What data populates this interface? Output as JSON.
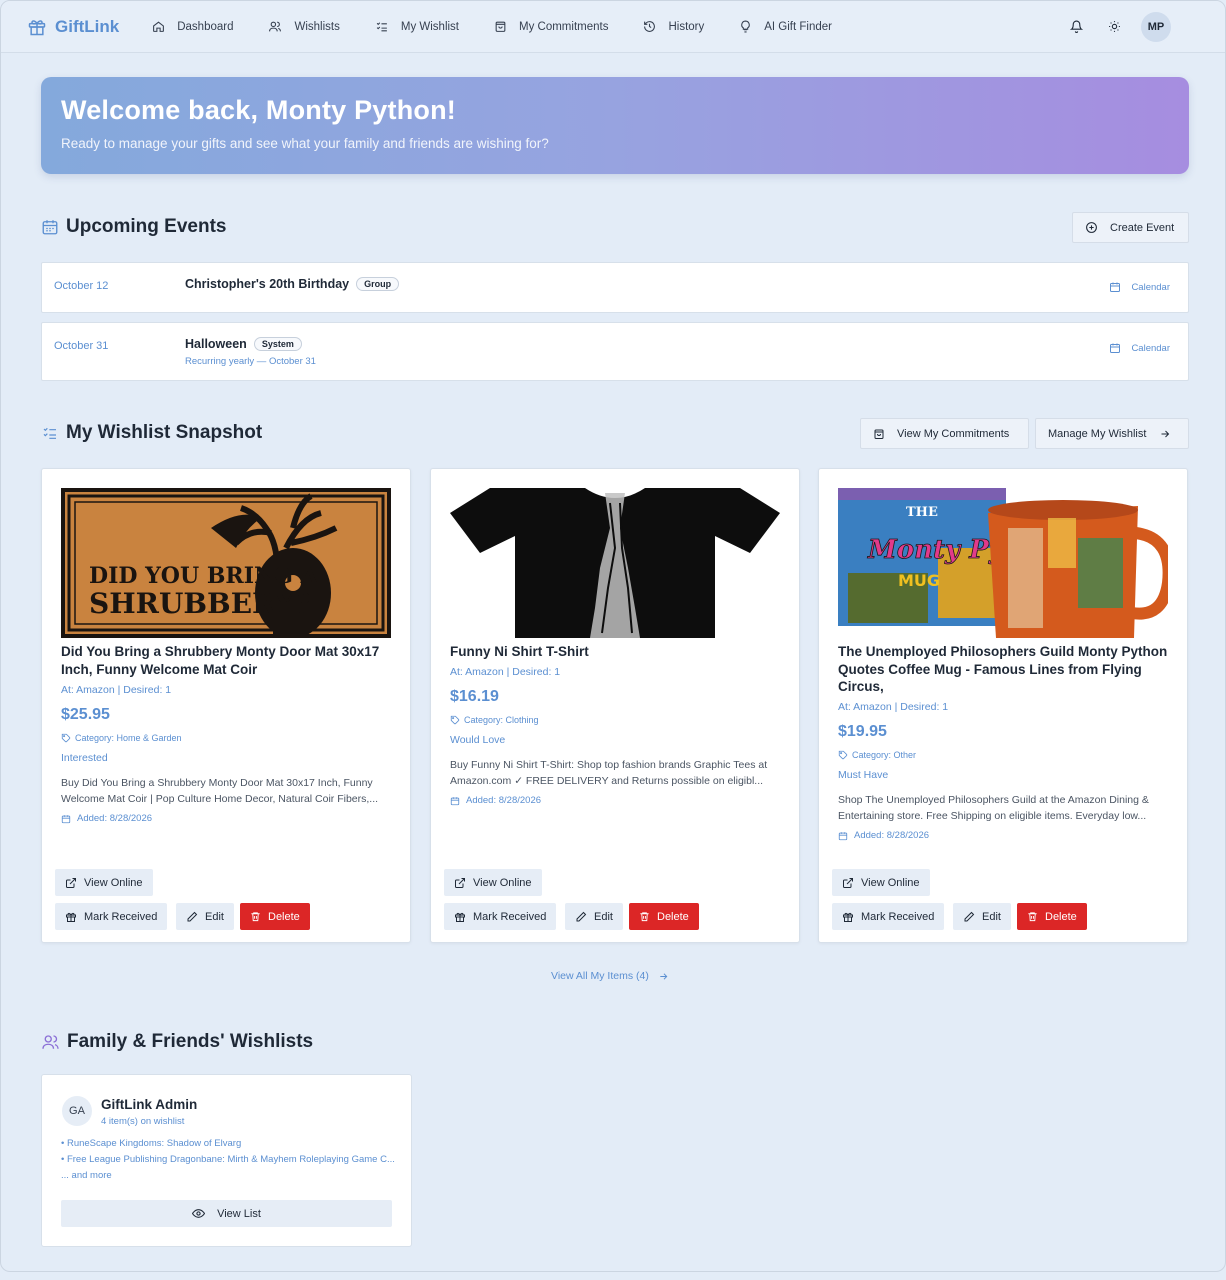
{
  "nav": {
    "brand": "GiftLink",
    "items": [
      {
        "label": "Dashboard",
        "icon": "home-icon"
      },
      {
        "label": "Wishlists",
        "icon": "users-icon"
      },
      {
        "label": "My Wishlist",
        "icon": "list-check-icon"
      },
      {
        "label": "My Commitments",
        "icon": "shopping-bag-icon"
      },
      {
        "label": "History",
        "icon": "history-icon"
      },
      {
        "label": "AI Gift Finder",
        "icon": "lightbulb-icon"
      }
    ],
    "avatar_initials": "MP"
  },
  "hero": {
    "title": "Welcome back, Monty Python!",
    "subtitle": "Ready to manage your gifts and see what your family and friends are wishing for?"
  },
  "events": {
    "title": "Upcoming Events",
    "create_label": "Create Event",
    "items": [
      {
        "date": "October 12",
        "title": "Christopher's 20th Birthday",
        "tag": "Group",
        "subtitle": "",
        "calendar_label": "Calendar"
      },
      {
        "date": "October 31",
        "title": "Halloween",
        "tag": "System",
        "subtitle": "Recurring yearly — October 31",
        "calendar_label": "Calendar"
      }
    ]
  },
  "wishlist": {
    "title": "My Wishlist Snapshot",
    "view_commitments_label": "View My Commitments",
    "manage_label": "Manage My Wishlist",
    "view_all_label": "View All My Items (4)",
    "items": [
      {
        "title": "Did You Bring a Shrubbery Monty Door Mat 30x17 Inch, Funny Welcome Mat Coir",
        "meta": "At: Amazon | Desired: 1",
        "price": "$25.95",
        "category": "Category: Home & Garden",
        "priority": "Interested",
        "description": "Buy Did You Bring a Shrubbery Monty Door Mat 30x17 Inch, Funny Welcome Mat Coir | Pop Culture Home Decor, Natural Coir Fibers,...",
        "added": "Added: 8/28/2026",
        "image_text_line1": "DID YOU BRING A",
        "image_text_line2": "SHRUBBERY?"
      },
      {
        "title": "Funny Ni Shirt T-Shirt",
        "meta": "At: Amazon | Desired: 1",
        "price": "$16.19",
        "category": "Category: Clothing",
        "priority": "Would Love",
        "description": "Buy Funny Ni Shirt T-Shirt: Shop top fashion brands Graphic Tees at Amazon.com ✓ FREE DELIVERY and Returns possible on eligibl...",
        "added": "Added: 8/28/2026"
      },
      {
        "title": "The Unemployed Philosophers Guild Monty Python Quotes Coffee Mug - Famous Lines from Flying Circus,",
        "meta": "At: Amazon | Desired: 1",
        "price": "$19.95",
        "category": "Category: Other",
        "priority": "Must Have",
        "description": "Shop The Unemployed Philosophers Guild at the Amazon Dining & Entertaining store. Free Shipping on eligible items. Everyday low...",
        "added": "Added: 8/28/2026",
        "image_text_the": "THE",
        "image_text_brand": "Monty Python",
        "image_text_mug": "MUG"
      }
    ],
    "buttons": {
      "view_online": "View Online",
      "mark_received": "Mark Received",
      "edit": "Edit",
      "delete": "Delete"
    }
  },
  "family": {
    "title": "Family & Friends' Wishlists",
    "cards": [
      {
        "initials": "GA",
        "name": "GiftLink Admin",
        "count": "4 item(s) on wishlist",
        "items": [
          "• RuneScape Kingdoms: Shadow of Elvarg",
          "• Free League Publishing Dragonbane: Mirth & Mayhem Roleplaying Game C..."
        ],
        "more": "... and more",
        "button": "View List"
      }
    ]
  },
  "colors": {
    "accent": "#5b8fd1",
    "danger": "#dc2626",
    "background": "#e3ecf7"
  }
}
